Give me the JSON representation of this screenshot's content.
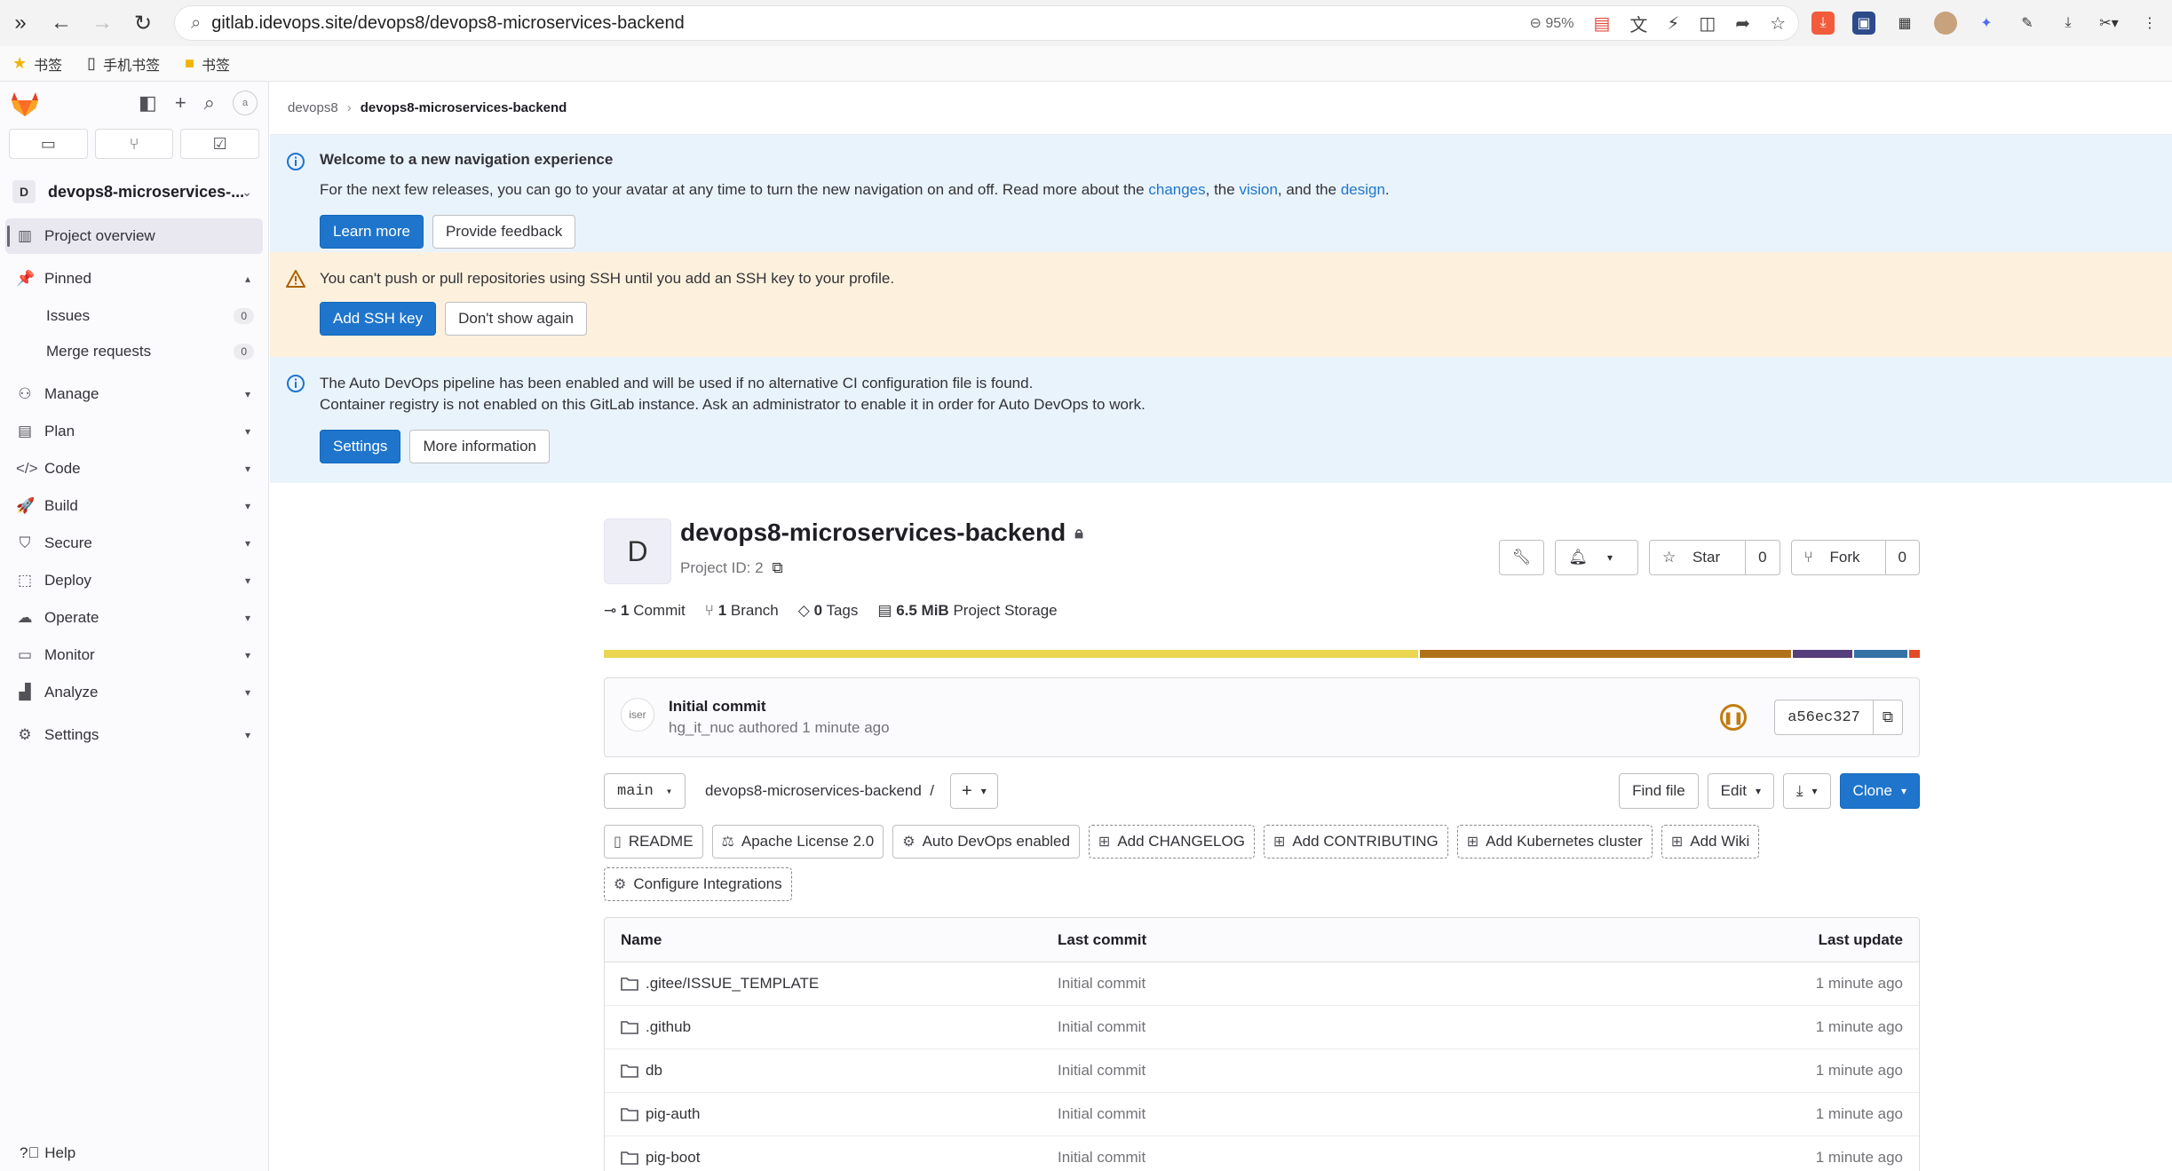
{
  "browser": {
    "url": "gitlab.idevops.site/devops8/devops8-microservices-backend",
    "zoom": "95%",
    "bookmarks": [
      "书签",
      "手机书签",
      "书签"
    ]
  },
  "sidebar": {
    "project_initial": "D",
    "project_name": "devops8-microservices-...",
    "avatar_alt": "a",
    "counts": [
      "",
      "",
      ""
    ],
    "items": [
      {
        "label": "Project overview",
        "icon": "project-icon"
      },
      {
        "label": "Pinned",
        "icon": "pin-icon"
      },
      {
        "label": "Manage",
        "icon": "users-icon"
      },
      {
        "label": "Plan",
        "icon": "planning-icon"
      },
      {
        "label": "Code",
        "icon": "code-icon"
      },
      {
        "label": "Build",
        "icon": "rocket-icon"
      },
      {
        "label": "Secure",
        "icon": "shield-icon"
      },
      {
        "label": "Deploy",
        "icon": "deployments-icon"
      },
      {
        "label": "Operate",
        "icon": "cloud-icon"
      },
      {
        "label": "Monitor",
        "icon": "monitor-icon"
      },
      {
        "label": "Analyze",
        "icon": "chart-icon"
      },
      {
        "label": "Settings",
        "icon": "gear-icon"
      }
    ],
    "pinned": [
      {
        "label": "Issues",
        "count": "0"
      },
      {
        "label": "Merge requests",
        "count": "0"
      }
    ],
    "help": "Help"
  },
  "breadcrumb": {
    "group": "devops8",
    "project": "devops8-microservices-backend"
  },
  "alerts": {
    "nav": {
      "title": "Welcome to a new navigation experience",
      "text_before": "For the next few releases, you can go to your avatar at any time to turn the new navigation on and off. Read more about the ",
      "link1": "changes",
      "mid1": ", the ",
      "link2": "vision",
      "mid2": ", and the ",
      "link3": "design",
      "end": ".",
      "btn_primary": "Learn more",
      "btn_secondary": "Provide feedback"
    },
    "ssh": {
      "text": "You can't push or pull repositories using SSH until you add an SSH key to your profile.",
      "btn_primary": "Add SSH key",
      "btn_secondary": "Don't show again"
    },
    "devops": {
      "line1": "The Auto DevOps pipeline has been enabled and will be used if no alternative CI configuration file is found.",
      "line2": "Container registry is not enabled on this GitLab instance. Ask an administrator to enable it in order for Auto DevOps to work.",
      "btn_primary": "Settings",
      "btn_secondary": "More information"
    }
  },
  "project": {
    "initial": "D",
    "name": "devops8-microservices-backend",
    "id_text": "Project ID: 2",
    "star_label": "Star",
    "star_count": "0",
    "fork_label": "Fork",
    "fork_count": "0",
    "stats": {
      "commits_n": "1",
      "commits_label": "Commit",
      "branches_n": "1",
      "branches_label": "Branch",
      "tags_n": "0",
      "tags_label": "Tags",
      "storage_n": "6.5 MiB",
      "storage_label": "Project Storage"
    }
  },
  "languages": [
    {
      "share": 62.2,
      "color": "#ead651"
    },
    {
      "share": 28.4,
      "color": "#b07219"
    },
    {
      "share": 4.5,
      "color": "#563d7c"
    },
    {
      "share": 4.1,
      "color": "#3572a5"
    },
    {
      "share": 0.8,
      "color": "#e34c26"
    }
  ],
  "last_commit": {
    "avatar_alt": "iser",
    "title": "Initial commit",
    "meta": "hg_it_nuc authored 1 minute ago",
    "sha": "a56ec327"
  },
  "repo": {
    "branch": "main",
    "path": "devops8-microservices-backend",
    "path_sep": "/",
    "find_file": "Find file",
    "edit": "Edit",
    "clone": "Clone"
  },
  "shortcuts": [
    {
      "label": "README",
      "style": "solid",
      "icon": "doc-icon"
    },
    {
      "label": "Apache License 2.0",
      "style": "solid",
      "icon": "scale-icon"
    },
    {
      "label": "Auto DevOps enabled",
      "style": "solid",
      "icon": "settings-icon"
    },
    {
      "label": "Add CHANGELOG",
      "style": "dashed",
      "icon": "plus-square-icon"
    },
    {
      "label": "Add CONTRIBUTING",
      "style": "dashed",
      "icon": "plus-square-icon"
    },
    {
      "label": "Add Kubernetes cluster",
      "style": "dashed",
      "icon": "plus-square-icon"
    },
    {
      "label": "Add Wiki",
      "style": "dashed",
      "icon": "plus-square-icon"
    },
    {
      "label": "Configure Integrations",
      "style": "dashed",
      "icon": "settings-icon"
    }
  ],
  "files": {
    "headers": {
      "name": "Name",
      "commit": "Last commit",
      "date": "Last update"
    },
    "rows": [
      {
        "name": ".gitee/ISSUE_TEMPLATE",
        "commit": "Initial commit",
        "date": "1 minute ago"
      },
      {
        "name": ".github",
        "commit": "Initial commit",
        "date": "1 minute ago"
      },
      {
        "name": "db",
        "commit": "Initial commit",
        "date": "1 minute ago"
      },
      {
        "name": "pig-auth",
        "commit": "Initial commit",
        "date": "1 minute ago"
      },
      {
        "name": "pig-boot",
        "commit": "Initial commit",
        "date": "1 minute ago"
      }
    ]
  }
}
